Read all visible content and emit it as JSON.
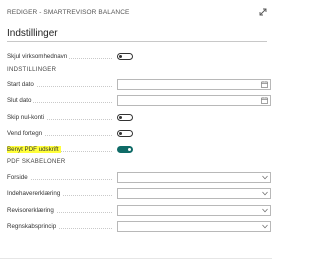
{
  "window": {
    "title": "REDIGER - SMARTREVISOR BALANCE"
  },
  "section": {
    "title": "Indstillinger"
  },
  "fields": {
    "skjul_virksomhedsnavn": {
      "label": "Skjul virksomhednavn",
      "value": "off"
    },
    "group_indstillinger": "INDSTILLINGER",
    "start_dato": {
      "label": "Start dato",
      "value": ""
    },
    "slut_dato": {
      "label": "Slut dato",
      "value": ""
    },
    "skip_nul_konti": {
      "label": "Skip nul-konti",
      "value": "off"
    },
    "vend_fortegn": {
      "label": "Vend fortegn",
      "value": "off"
    },
    "benyt_pdf_udskrift": {
      "label": "Benyt PDF udskrift",
      "value": "on"
    },
    "group_pdf": "PDF SKABELONER",
    "forside": {
      "label": "Forside",
      "value": ""
    },
    "indehavererklaering": {
      "label": "Indehavererklæring",
      "value": ""
    },
    "revisorerklaering": {
      "label": "Revisorerklæring",
      "value": ""
    },
    "regnskabsprincip": {
      "label": "Regnskabsprincip",
      "value": ""
    }
  },
  "colors": {
    "toggle_on": "#0f6b67",
    "highlight": "#ffff3a"
  },
  "icons": {
    "expand": "expand-icon",
    "calendar": "calendar-icon",
    "dropdown": "chevron-down-icon"
  }
}
